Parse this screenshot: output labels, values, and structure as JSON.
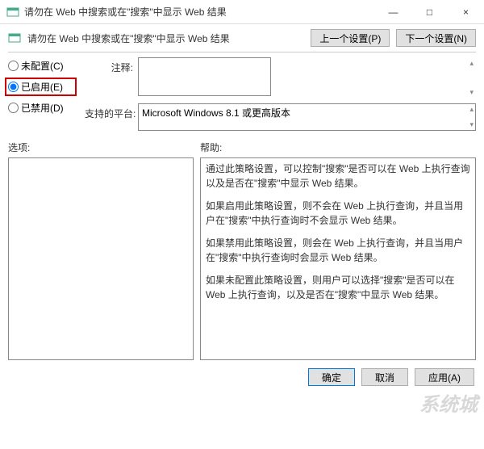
{
  "window": {
    "title": "请勿在 Web 中搜索或在\"搜索\"中显示 Web 结果",
    "minimize": "—",
    "maximize": "□",
    "close": "×"
  },
  "header": {
    "policy_title": "请勿在 Web 中搜索或在\"搜索\"中显示 Web 结果",
    "prev_btn": "上一个设置(P)",
    "next_btn": "下一个设置(N)"
  },
  "config": {
    "not_configured": "未配置(C)",
    "enabled": "已启用(E)",
    "disabled": "已禁用(D)",
    "comment_label": "注释:",
    "comment_value": "",
    "platform_label": "支持的平台:",
    "platform_value": "Microsoft Windows 8.1 或更高版本"
  },
  "lower": {
    "options_label": "选项:",
    "help_label": "帮助:",
    "help_paragraphs": [
      "通过此策略设置，可以控制\"搜索\"是否可以在 Web 上执行查询以及是否在\"搜索\"中显示 Web 结果。",
      "如果启用此策略设置，则不会在 Web 上执行查询，并且当用户在\"搜索\"中执行查询时不会显示 Web 结果。",
      "如果禁用此策略设置，则会在 Web 上执行查询，并且当用户在\"搜索\"中执行查询时会显示 Web 结果。",
      "如果未配置此策略设置，则用户可以选择\"搜索\"是否可以在 Web 上执行查询，以及是否在\"搜索\"中显示 Web 结果。"
    ]
  },
  "buttons": {
    "ok": "确定",
    "cancel": "取消",
    "apply": "应用(A)"
  },
  "watermark": "系统城"
}
